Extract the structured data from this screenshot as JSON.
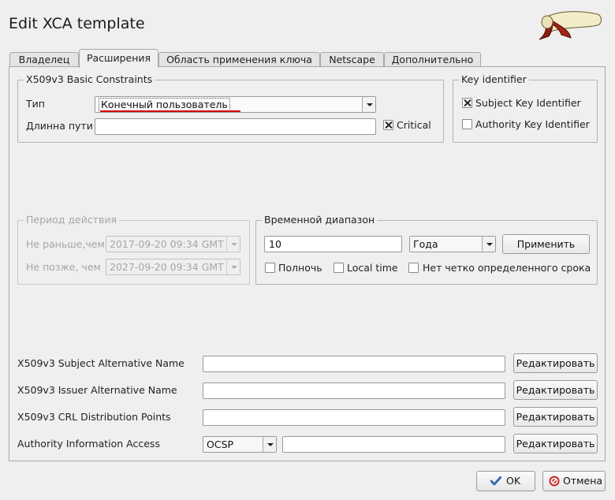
{
  "window": {
    "title": "Edit XCA template"
  },
  "tabs": [
    {
      "label": "Владелец",
      "active": false
    },
    {
      "label": "Расширения",
      "active": true
    },
    {
      "label": "Область применения ключа",
      "active": false
    },
    {
      "label": "Netscape",
      "active": false
    },
    {
      "label": "Дополнительно",
      "active": false
    }
  ],
  "basic_constraints": {
    "legend": "X509v3 Basic Constraints",
    "type_label": "Тип",
    "type_value": "Конечный пользователь",
    "path_label": "Длинна пути",
    "path_value": "",
    "critical_label": "Critical",
    "critical_checked": true
  },
  "key_identifier": {
    "legend": "Key identifier",
    "subject_label": "Subject Key Identifier",
    "subject_checked": true,
    "authority_label": "Authority Key Identifier",
    "authority_checked": false
  },
  "validity": {
    "legend": "Период действия",
    "not_before_label": "Не раньше,чем",
    "not_before_value": "2017-09-20 09:34 GMT",
    "not_after_label": "Не позже, чем",
    "not_after_value": "2027-09-20 09:34 GMT"
  },
  "time_range": {
    "legend": "Временной диапазон",
    "amount": "10",
    "unit": "Года",
    "apply_label": "Применить",
    "midnight_label": "Полночь",
    "midnight_checked": false,
    "local_time_label": "Local time",
    "local_time_checked": false,
    "undefined_label": "Нет четко определенного срока",
    "undefined_checked": false
  },
  "extensions": [
    {
      "label": "X509v3 Subject Alternative Name",
      "value": "",
      "button": "Редактировать"
    },
    {
      "label": "X509v3 Issuer Alternative Name",
      "value": "",
      "button": "Редактировать"
    },
    {
      "label": "X509v3 CRL Distribution Points",
      "value": "",
      "button": "Редактировать"
    },
    {
      "label": "Authority Information Access",
      "value": "",
      "button": "Редактировать",
      "method": "OCSP"
    }
  ],
  "footer": {
    "ok_label": "OK",
    "cancel_label": "Отмена"
  },
  "colors": {
    "annotation_underline": "#d40000",
    "ok_icon": "#3b6db4",
    "cancel_icon": "#cc2a2a"
  }
}
